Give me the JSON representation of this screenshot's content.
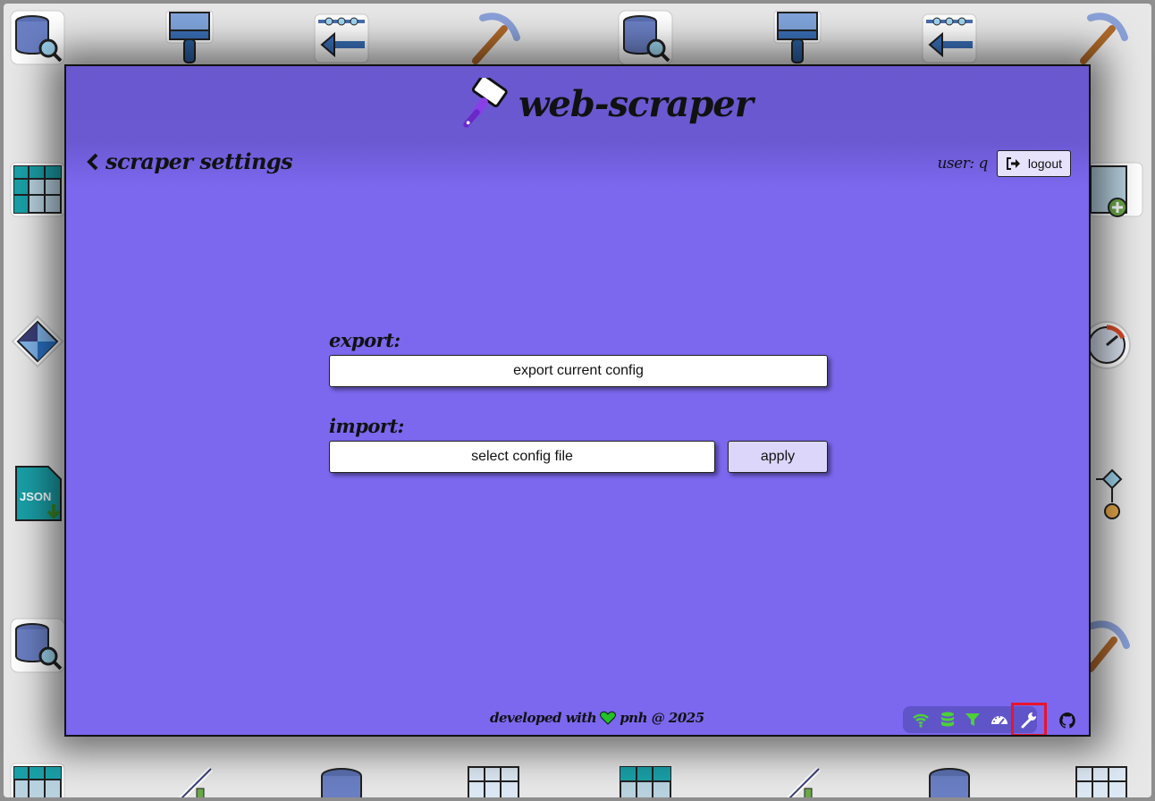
{
  "app": {
    "title": "web-scraper"
  },
  "header": {
    "back_label": "scraper settings",
    "user_label": "user: q",
    "logout_label": "logout"
  },
  "settings": {
    "export_label": "export:",
    "export_button": "export current config",
    "import_label": "import:",
    "select_file_button": "select config file",
    "apply_button": "apply"
  },
  "footer": {
    "before_heart": "developed with",
    "after_heart": "pnh @ 2025"
  },
  "toolbar": {
    "icons": [
      "wifi-icon",
      "database-icon",
      "filter-icon",
      "dashboard-icon",
      "wrench-icon"
    ],
    "selected": "wrench-icon",
    "github": "github-icon"
  },
  "colors": {
    "background": "#7b68ee",
    "header": "#6a58cf",
    "toolbar": "#6054c9",
    "selected_outline": "#e8142c",
    "heart": "#22c02a",
    "toolbar_green": "#4cd137"
  }
}
